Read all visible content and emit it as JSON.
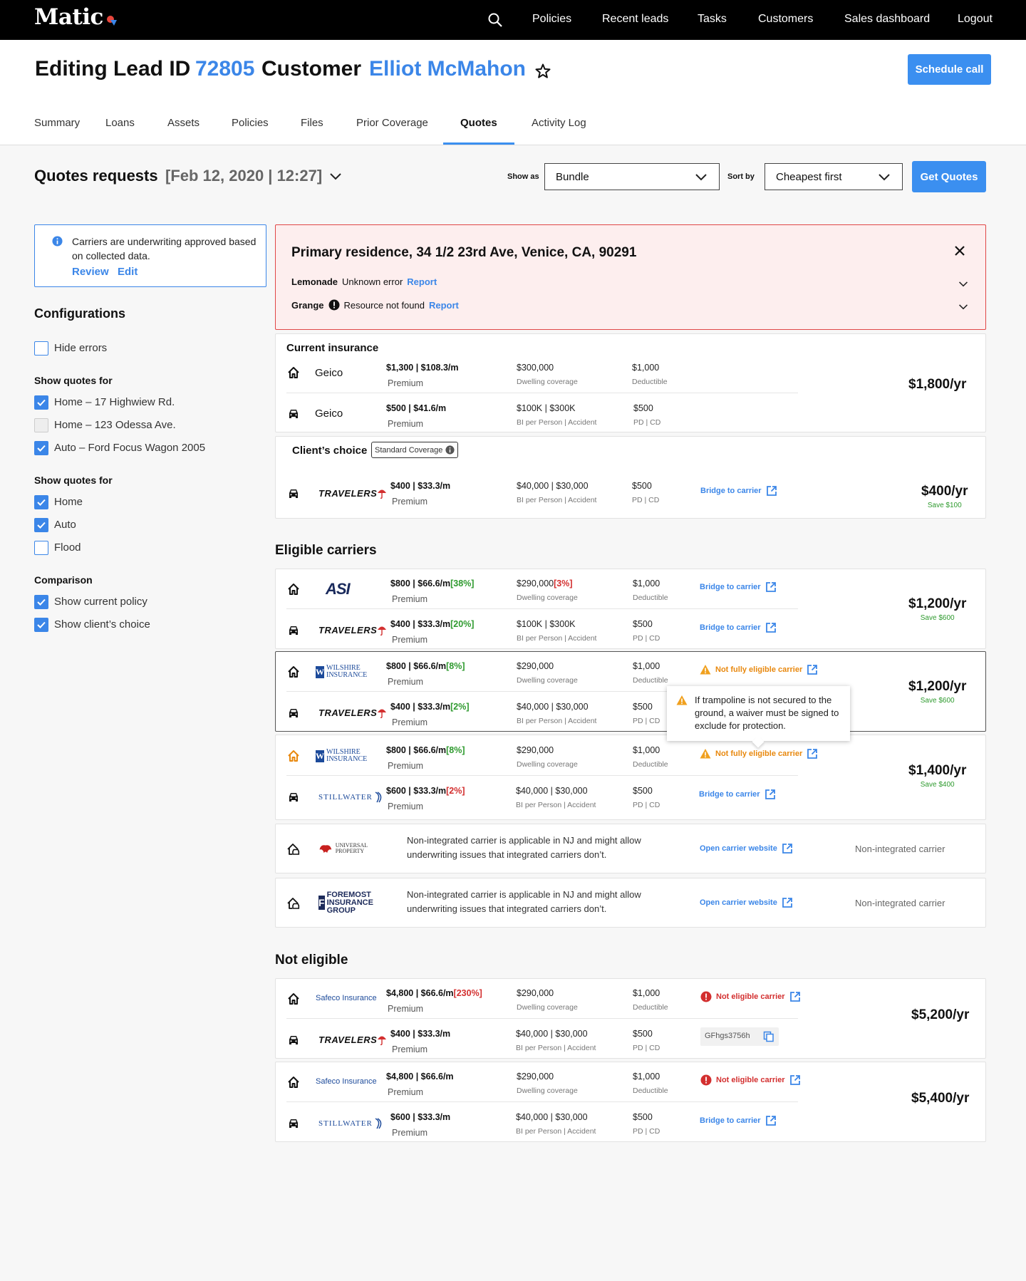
{
  "app": {
    "brand": "Matic",
    "accent": "#3b86e8",
    "danger": "#d32f2f",
    "warning": "#e8880e",
    "success": "#2e9a2e"
  },
  "nav": {
    "items": [
      "Policies",
      "Recent leads",
      "Tasks",
      "Customers",
      "Sales dashboard",
      "Logout"
    ],
    "search_icon": "search-icon"
  },
  "header": {
    "editing_label": "Editing Lead ID",
    "lead_id": "72805",
    "customer_label": "Customer",
    "customer_name": "Elliot McMahon",
    "schedule_call": "Schedule call"
  },
  "tabs": [
    "Summary",
    "Loans",
    "Assets",
    "Policies",
    "Files",
    "Prior Coverage",
    "Quotes",
    "Activity Log"
  ],
  "active_tab": "Quotes",
  "quotes_request": {
    "title": "Quotes requests",
    "date": "[Feb 12, 2020 | 12:27]",
    "show_as_label": "Show as",
    "show_as_value": "Bundle",
    "sort_by_label": "Sort by",
    "sort_by_value": "Cheapest first",
    "get_quotes": "Get Quotes"
  },
  "info": {
    "text": "Carriers are underwriting approved based on collected data.",
    "review": "Review",
    "edit": "Edit"
  },
  "configurations": {
    "title": "Configurations",
    "hide_errors": "Hide errors",
    "show_quotes_for_1": "Show quotes for",
    "assets": [
      "Home – 17 Highwiew Rd.",
      "Home – 123 Odessa Ave.",
      "Auto – Ford Focus Wagon 2005"
    ],
    "show_quotes_for_2": "Show quotes for",
    "types": [
      "Home",
      "Auto",
      "Flood"
    ],
    "comparison_title": "Comparison",
    "comparison": [
      "Show current policy",
      "Show client’s choice"
    ]
  },
  "error_panel": {
    "title": "Primary residence, 34 1/2 23rd Ave, Venice, CA, 90291",
    "rows": [
      {
        "carrier": "Lemonade",
        "message": "Unknown error",
        "link": "Report"
      },
      {
        "carrier": "Grange",
        "message": "Resource not found",
        "link": "Report"
      }
    ]
  },
  "current_insurance": {
    "title": "Current insurance",
    "home": {
      "carrier": "Geico",
      "premium": "$1,300 | $108.3/m",
      "premium_label": "Premium",
      "coverage": "$300,000",
      "coverage_label": "Dwelling coverage",
      "deductible": "$1,000",
      "deductible_label": "Deductible"
    },
    "auto": {
      "carrier": "Geico",
      "premium": "$500 | $41.6/m",
      "premium_label": "Premium",
      "coverage": "$100K | $300K",
      "coverage_label": "BI per Person | Accident",
      "deductible": "$500",
      "deductible_label": "PD | CD"
    },
    "total": "$1,800/yr"
  },
  "clients_choice": {
    "title": "Client’s choice",
    "badge": "Standard Coverage",
    "carrier": "TRAVELERS",
    "premium": "$400 | $33.3/m",
    "premium_label": "Premium",
    "coverage": "$40,000 | $30,000",
    "coverage_label": "BI per Person | Accident",
    "deductible": "$500",
    "deductible_label": "PD | CD",
    "bridge": "Bridge to carrier",
    "total": "$400/yr",
    "save": "Save $100"
  },
  "eligible": {
    "title": "Eligible carriers",
    "bundles": [
      {
        "home": {
          "carrier": "ASI",
          "premium": "$800 | $66.6/m",
          "premium_delta": "[38%]",
          "premium_label": "Premium",
          "coverage": "$290,000",
          "coverage_delta": "[3%]",
          "coverage_label": "Dwelling coverage",
          "deductible": "$1,000",
          "deductible_label": "Deductible",
          "link": "Bridge to carrier"
        },
        "auto": {
          "carrier": "TRAVELERS",
          "premium": "$400 | $33.3/m",
          "premium_delta": "[20%]",
          "premium_label": "Premium",
          "coverage": "$100K | $300K",
          "coverage_label": "BI per Person | Accident",
          "deductible": "$500",
          "deductible_label": "PD | CD",
          "link": "Bridge to carrier"
        },
        "total": "$1,200/yr",
        "save": "Save $600"
      },
      {
        "home": {
          "carrier": "WILSHIRE INSURANCE",
          "premium": "$800 | $66.6/m",
          "premium_delta": "[8%]",
          "premium_label": "Premium",
          "coverage": "$290,000",
          "coverage_label": "Dwelling coverage",
          "deductible": "$1,000",
          "deductible_label": "Deductible",
          "link": "Not fully eligible carrier"
        },
        "auto": {
          "carrier": "TRAVELERS",
          "premium": "$400 | $33.3/m",
          "premium_delta": "[2%]",
          "premium_label": "Premium",
          "coverage": "$40,000 | $30,000",
          "coverage_label": "BI per Person | Accident",
          "deductible": "$500",
          "deductible_label": "PD | CD"
        },
        "total": "$1,200/yr",
        "save": "Save $600"
      },
      {
        "home": {
          "carrier": "WILSHIRE INSURANCE",
          "premium": "$800 | $66.6/m",
          "premium_delta": "[8%]",
          "premium_label": "Premium",
          "coverage": "$290,000",
          "coverage_label": "Dwelling coverage",
          "deductible": "$1,000",
          "deductible_label": "Deductible",
          "link": "Not fully eligible carrier"
        },
        "auto": {
          "carrier": "STILLWATER",
          "premium": "$600 | $33.3/m",
          "premium_delta": "[2%]",
          "premium_label": "Premium",
          "coverage": "$40,000 | $30,000",
          "coverage_label": "BI per Person | Accident",
          "deductible": "$500",
          "deductible_label": "PD | CD",
          "link": "Bridge to carrier"
        },
        "total": "$1,400/yr",
        "save": "Save $400"
      }
    ],
    "tooltip": "If trampoline is not secured to the ground, a waiver must be signed to exclude for protection.",
    "non_integrated": [
      {
        "carrier": "UNIVERSAL PROPERTY",
        "description": "Non-integrated carrier is applicable in NJ and might allow underwriting issues that integrated carriers don’t.",
        "link": "Open carrier website",
        "tag": "Non-integrated carrier"
      },
      {
        "carrier": "FOREMOST INSURANCE GROUP",
        "description": "Non-integrated carrier is applicable in NJ and might allow underwriting issues that integrated carriers don’t.",
        "link": "Open carrier website",
        "tag": "Non-integrated carrier"
      }
    ]
  },
  "not_eligible": {
    "title": "Not eligible",
    "bundles": [
      {
        "home": {
          "carrier": "Safeco Insurance",
          "premium": "$4,800 | $66.6/m",
          "premium_delta": "[230%]",
          "premium_label": "Premium",
          "coverage": "$290,000",
          "coverage_label": "Dwelling coverage",
          "deductible": "$1,000",
          "deductible_label": "Deductible",
          "link": "Not eligible carrier"
        },
        "auto": {
          "carrier": "TRAVELERS",
          "premium": "$400 | $33.3/m",
          "premium_label": "Premium",
          "coverage": "$40,000 | $30,000",
          "coverage_label": "BI per Person | Accident",
          "deductible": "$500",
          "deductible_label": "PD | CD",
          "code": "GFhgs3756h"
        },
        "total": "$5,200/yr"
      },
      {
        "home": {
          "carrier": "Safeco Insurance",
          "premium": "$4,800 | $66.6/m",
          "premium_label": "Premium",
          "coverage": "$290,000",
          "coverage_label": "Dwelling coverage",
          "deductible": "$1,000",
          "deductible_label": "Deductible",
          "link": "Not eligible carrier"
        },
        "auto": {
          "carrier": "STILLWATER",
          "premium": "$600 | $33.3/m",
          "premium_label": "Premium",
          "coverage": "$40,000 | $30,000",
          "coverage_label": "BI per Person | Accident",
          "deductible": "$500",
          "deductible_label": "PD | CD",
          "link": "Bridge to carrier"
        },
        "total": "$5,400/yr"
      }
    ]
  }
}
